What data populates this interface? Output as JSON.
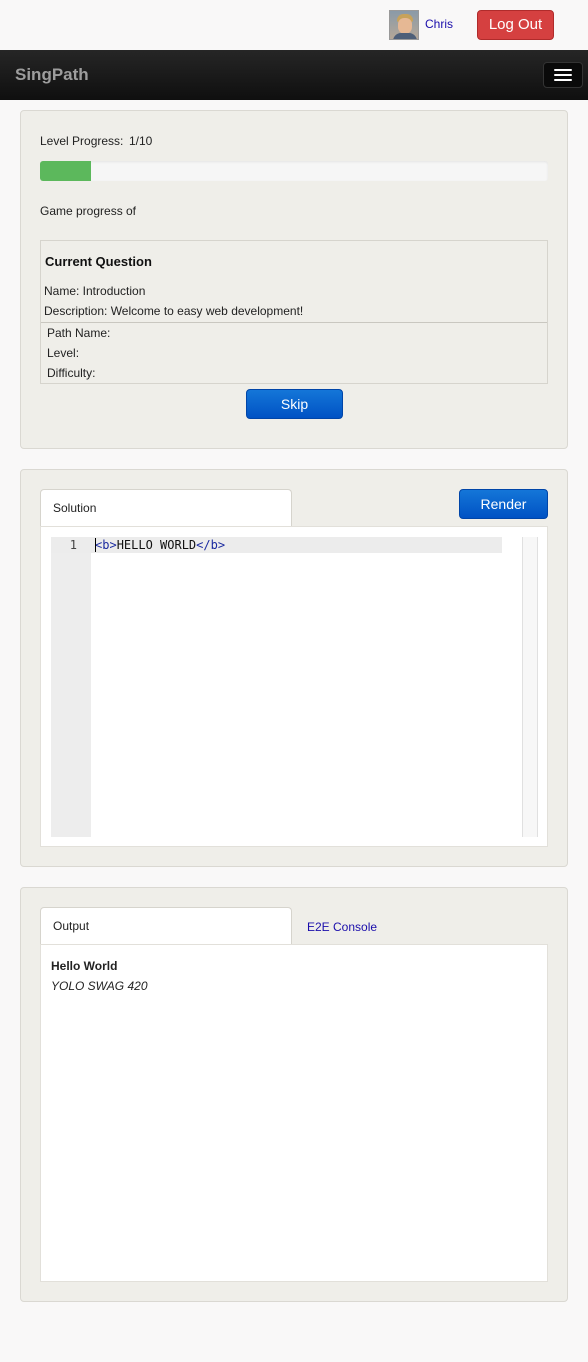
{
  "header": {
    "user_name": "Chris",
    "logout_label": "Log Out"
  },
  "navbar": {
    "brand": "SingPath"
  },
  "progress": {
    "level_label": "Level Progress:",
    "level_value": "1/10",
    "level_fraction": 0.1,
    "game_label": "Game progress",
    "game_of": "of"
  },
  "question": {
    "title": "Current Question",
    "name": "Name: Introduction",
    "description": "Description: Welcome to easy web development!",
    "path_name": "Path Name:",
    "level": "Level:",
    "difficulty": "Difficulty:",
    "skip_label": "Skip"
  },
  "editor": {
    "tab_label": "Solution",
    "render_label": "Render",
    "line_number": "1",
    "code": {
      "open_tag": "<b>",
      "text": "HELLO WORLD",
      "close_tag": "</b>"
    }
  },
  "output": {
    "tab_output": "Output",
    "tab_console": "E2E Console",
    "bold_line": "Hello World",
    "italic_line": "YOLO SWAG 420"
  },
  "colors": {
    "navbar": "#1b1b1b",
    "logout": "#d54040",
    "primary": "#0a64d0",
    "progress": "#5cb85c",
    "link": "#1a0dab"
  }
}
